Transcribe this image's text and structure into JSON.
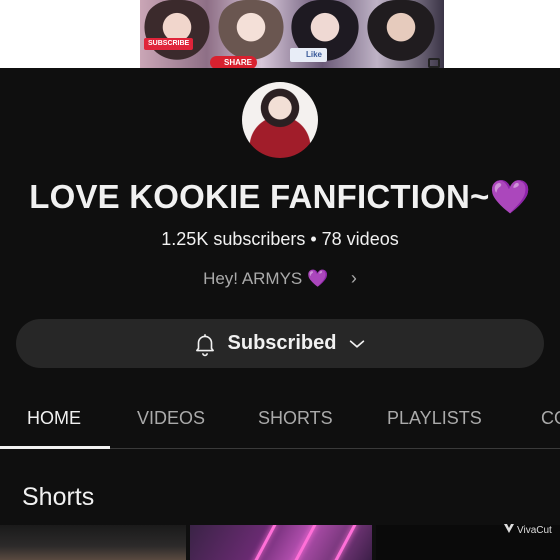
{
  "banner": {
    "subscribe_badge": "SUBSCRIBE",
    "share_badge": "SHARE",
    "like_badge": "Like"
  },
  "channel": {
    "name": "LOVE KOOKIE FANFICTION~",
    "name_emoji": "💜",
    "stats": "1.25K subscribers • 78 videos",
    "description": "Hey! ARMYS",
    "description_emoji": "💜",
    "description_chevron": "›"
  },
  "subscribe_button": {
    "label": "Subscribed",
    "icon_left": "bell-icon",
    "icon_right": "chevron-down-icon"
  },
  "tabs": [
    {
      "label": "HOME",
      "active": true
    },
    {
      "label": "VIDEOS",
      "active": false
    },
    {
      "label": "SHORTS",
      "active": false
    },
    {
      "label": "PLAYLISTS",
      "active": false
    },
    {
      "label": "CO",
      "active": false
    }
  ],
  "shorts": {
    "title": "Shorts"
  },
  "watermark": {
    "label": "VivaCut"
  },
  "colors": {
    "background": "#0f0f0f",
    "button_bg": "#272727",
    "accent_purple": "#a64bf4",
    "text_primary": "#f1f1f1",
    "text_secondary": "#aaaaaa"
  }
}
